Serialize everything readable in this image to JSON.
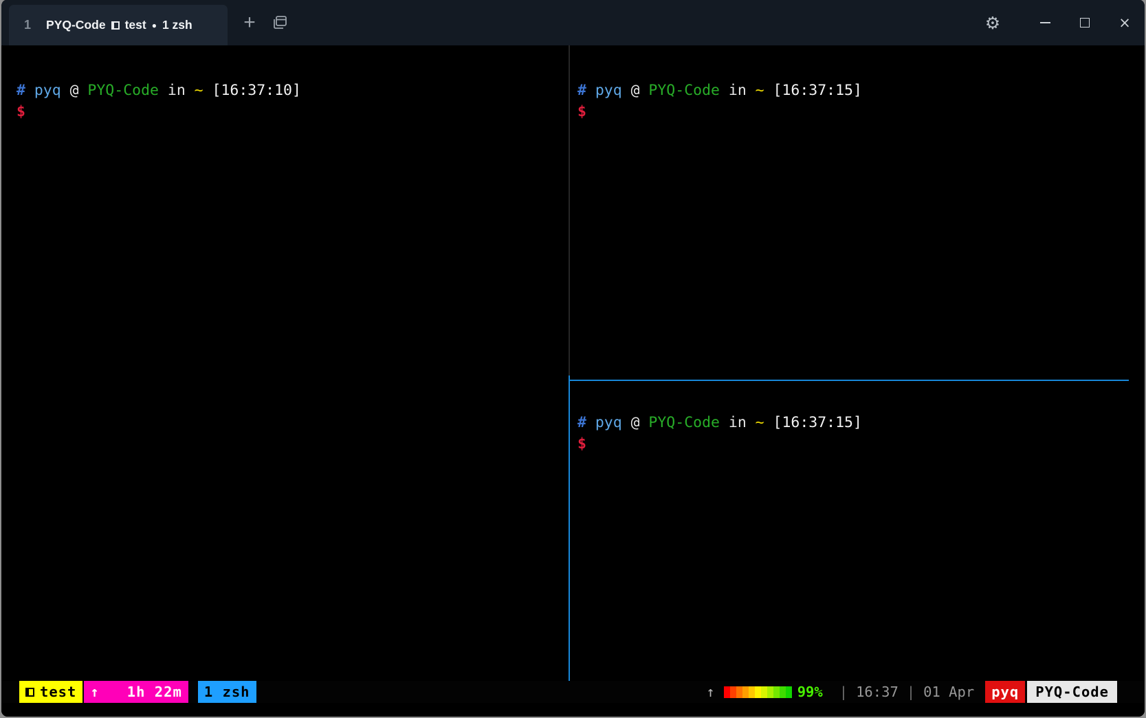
{
  "titlebar": {
    "tab": {
      "number": "1",
      "session": "PYQ-Code",
      "window": "test",
      "dot": "●",
      "pane": "1 zsh"
    },
    "new_tab_label": "+",
    "icons": {
      "settings_gear": "⚙",
      "close": "×"
    }
  },
  "panes": [
    {
      "prompt_symbol": "#",
      "user": "pyq",
      "at": "@",
      "host": "PYQ-Code",
      "in_word": "in",
      "path": "~",
      "timestamp": "[16:37:10]",
      "cursor": "$"
    },
    {
      "prompt_symbol": "#",
      "user": "pyq",
      "at": "@",
      "host": "PYQ-Code",
      "in_word": "in",
      "path": "~",
      "timestamp": "[16:37:15]",
      "cursor": "$"
    },
    {
      "prompt_symbol": "#",
      "user": "pyq",
      "at": "@",
      "host": "PYQ-Code",
      "in_word": "in",
      "path": "~",
      "timestamp": "[16:37:15]",
      "cursor": "$"
    }
  ],
  "status_bar": {
    "session": {
      "label": "test"
    },
    "uptime": {
      "arrow": "↑",
      "label": "1h 22m"
    },
    "window": {
      "label": "1 zsh"
    },
    "right": {
      "arrow": "↑",
      "percent": "99%",
      "separator": "|",
      "time": "16:37",
      "date": "01 Apr",
      "user": "pyq",
      "host": "PYQ-Code"
    },
    "gradient_colors": [
      "#ff0000",
      "#ff4000",
      "#ff7300",
      "#ff9e00",
      "#ffc800",
      "#fff200",
      "#d8f400",
      "#a8ef00",
      "#74e600",
      "#3fdc00",
      "#12d500"
    ]
  },
  "colors": {
    "titlebar_bg": "#131a23",
    "tab_bg": "#1d2632",
    "terminal_bg": "#000000",
    "active_pane_border": "#1787d8",
    "inactive_pane_border": "#262626",
    "prompt_hash_blue": "#3c74d2",
    "prompt_user_blue": "#5fa8e7",
    "prompt_host_green": "#28ad28",
    "prompt_path_yellow": "#f0dc00",
    "prompt_cursor_red": "#e01e3c",
    "badge_session_yellow": "#ffff00",
    "badge_uptime_magenta": "#ff00b8",
    "badge_window_blue": "#1e9fff",
    "badge_user_red": "#e01010",
    "badge_host_gray": "#e7e7e7",
    "percent_green": "#48f000"
  }
}
